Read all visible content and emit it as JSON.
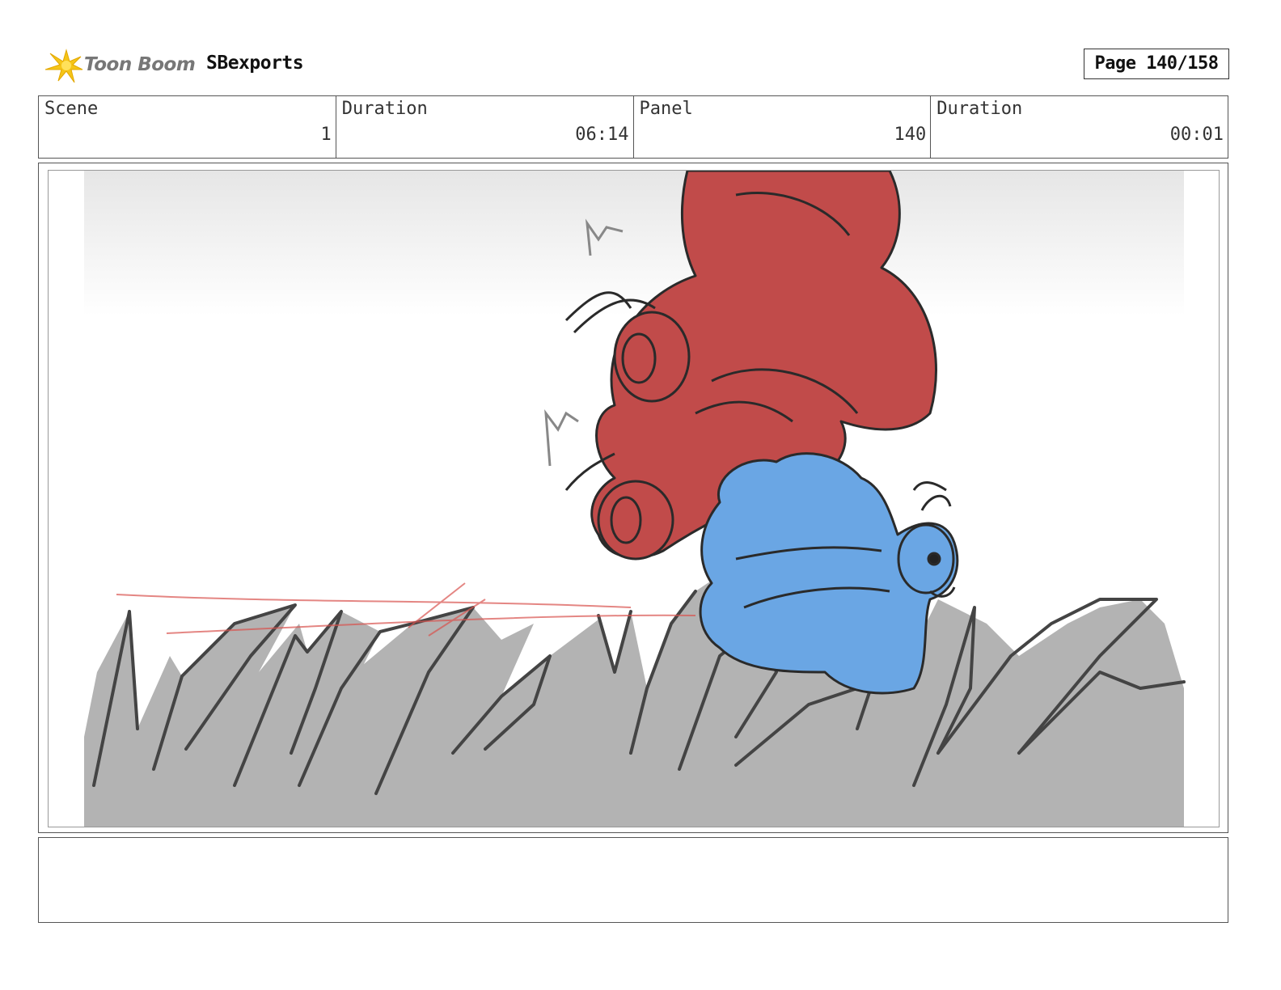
{
  "header": {
    "logo_text": "Toon Boom",
    "project_name": "SBexports",
    "page_label": "Page 140/158"
  },
  "info": {
    "scene_label": "Scene",
    "scene_value": "1",
    "scene_duration_label": "Duration",
    "scene_duration_value": "06:14",
    "panel_label": "Panel",
    "panel_value": "140",
    "panel_duration_label": "Duration",
    "panel_duration_value": "00:01"
  },
  "colors": {
    "red_character": "#c14b4a",
    "blue_character": "#6aa6e4",
    "grass": "#b3b3b3",
    "outline": "#2a2a2a",
    "speed_line": "#d9534f",
    "logo_star": "#f5c518"
  }
}
